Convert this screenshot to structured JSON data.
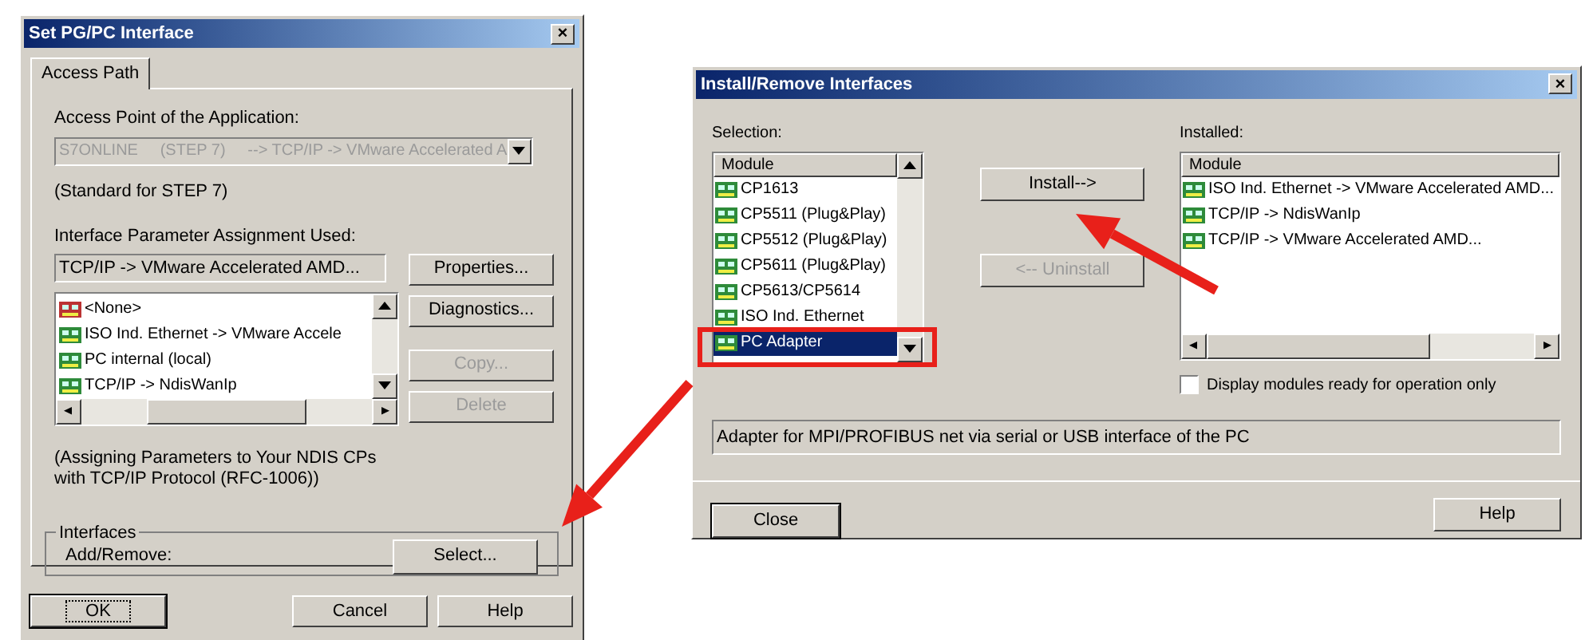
{
  "set_pg_pc_dialog": {
    "title": "Set PG/PC Interface",
    "close": "×",
    "tabs": [
      {
        "label": "Access Path",
        "selected": true
      }
    ],
    "access_point_label": "Access Point of the Application:",
    "access_point": {
      "value": "S7ONLINE     (STEP 7)     --> TCP/IP -> VMware Accelerated A",
      "disabled": true
    },
    "standard_note": "(Standard for STEP 7)",
    "assignment_label": "Interface Parameter Assignment Used:",
    "assignment_value": "TCP/IP -> VMware Accelerated AMD...",
    "assignment_list": [
      {
        "label": "<None>",
        "kind": "none",
        "selected": false
      },
      {
        "label": "ISO Ind. Ethernet -> VMware Accele",
        "kind": "card",
        "selected": false
      },
      {
        "label": "PC internal (local)",
        "kind": "card",
        "selected": false
      },
      {
        "label": "TCP/IP -> NdisWanIp",
        "kind": "card",
        "selected": false
      }
    ],
    "side_buttons": [
      {
        "label": "Properties...",
        "disabled": false
      },
      {
        "label": "Diagnostics...",
        "disabled": false
      },
      {
        "label": "Copy...",
        "disabled": true
      },
      {
        "label": "Delete",
        "disabled": true
      }
    ],
    "assignment_note": "(Assigning Parameters to Your NDIS CPs with TCP/IP Protocol (RFC-1006))",
    "interfaces_group": {
      "title": "Interfaces",
      "label": "Add/Remove:",
      "button": "Select..."
    },
    "buttons": [
      {
        "label": "OK",
        "focused": true
      },
      {
        "label": "Cancel",
        "focused": false
      },
      {
        "label": "Help",
        "focused": false
      }
    ]
  },
  "install_dialog": {
    "title": "Install/Remove Interfaces",
    "close": "×",
    "selection_label": "Selection:",
    "selection_header": "Module",
    "selection_list": [
      {
        "label": "CP1613",
        "selected": false
      },
      {
        "label": "CP5511 (Plug&Play)",
        "selected": false
      },
      {
        "label": "CP5512 (Plug&Play)",
        "selected": false
      },
      {
        "label": "CP5611 (Plug&Play)",
        "selected": false
      },
      {
        "label": "CP5613/CP5614",
        "selected": false
      },
      {
        "label": "ISO Ind. Ethernet",
        "selected": false
      },
      {
        "label": "PC Adapter",
        "selected": true
      }
    ],
    "install_button": {
      "label": "Install-->",
      "disabled": false
    },
    "uninstall_button": {
      "label": "<-- Uninstall",
      "disabled": true
    },
    "installed_label": "Installed:",
    "installed_header": "Module",
    "installed_list": [
      {
        "label": "ISO Ind. Ethernet -> VMware Accelerated AMD..."
      },
      {
        "label": "TCP/IP -> NdisWanIp"
      },
      {
        "label": "TCP/IP -> VMware Accelerated AMD..."
      }
    ],
    "ready_only": {
      "label": "Display modules ready for operation only",
      "checked": false
    },
    "description": "Adapter for MPI/PROFIBUS net via serial or USB interface of the PC",
    "buttons": [
      {
        "label": "Close",
        "kind": "close"
      },
      {
        "label": "Help",
        "kind": "help"
      }
    ]
  }
}
